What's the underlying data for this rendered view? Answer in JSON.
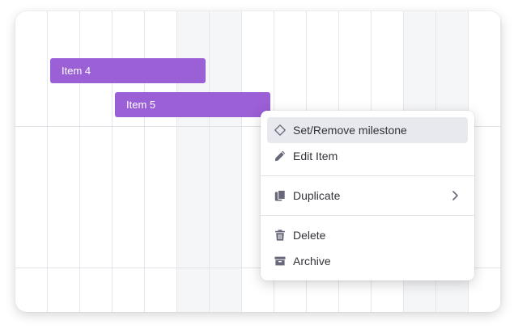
{
  "gantt": {
    "items": [
      {
        "label": "Item 4"
      },
      {
        "label": "Item 5"
      }
    ],
    "bar_color": "#9b5fd6"
  },
  "context_menu": {
    "items": [
      {
        "label": "Set/Remove milestone",
        "icon": "diamond-icon"
      },
      {
        "label": "Edit Item",
        "icon": "pencil-icon"
      },
      {
        "label": "Duplicate",
        "icon": "duplicate-icon",
        "submenu": true
      },
      {
        "label": "Delete",
        "icon": "trash-icon"
      },
      {
        "label": "Archive",
        "icon": "archive-icon"
      }
    ],
    "hover_color": "#e7e9ef"
  }
}
